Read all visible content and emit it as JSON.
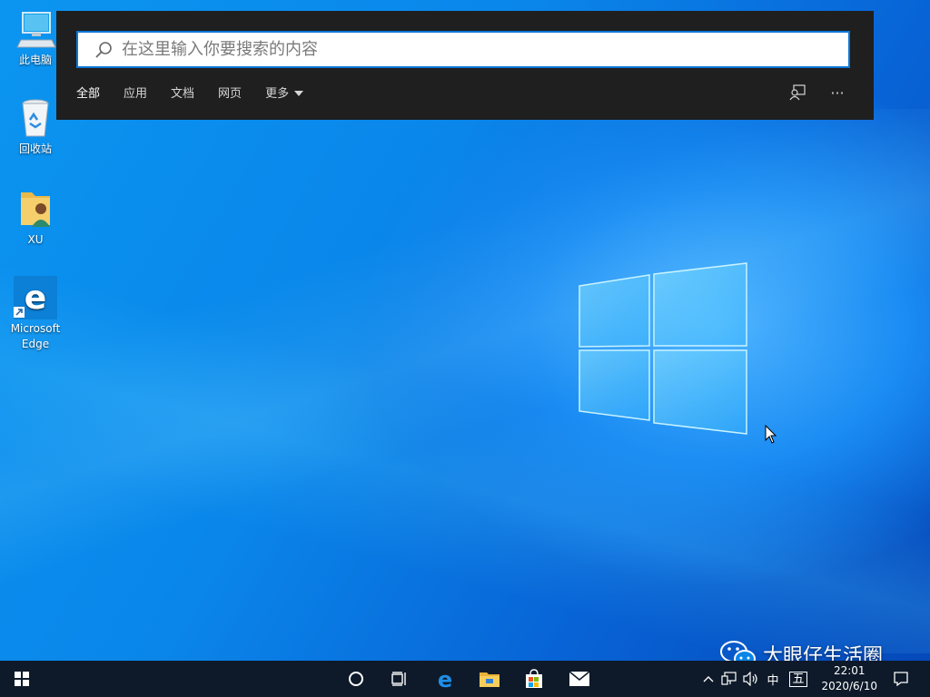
{
  "desktop": {
    "icons": [
      {
        "label": "此电脑",
        "icon": "computer-icon"
      },
      {
        "label": "回收站",
        "icon": "recycle-bin-icon"
      },
      {
        "label": "XU",
        "icon": "user-folder-icon"
      },
      {
        "label": "Microsoft\nEdge",
        "icon": "edge-icon"
      }
    ]
  },
  "search": {
    "placeholder": "在这里输入你要搜索的内容",
    "value": "",
    "tabs": [
      {
        "label": "全部",
        "active": true
      },
      {
        "label": "应用",
        "active": false
      },
      {
        "label": "文档",
        "active": false
      },
      {
        "label": "网页",
        "active": false
      },
      {
        "label": "更多",
        "active": false,
        "dropdown": true
      }
    ],
    "feedback_icon": "feedback-icon",
    "more_icon": "ellipsis-icon",
    "more_glyph": "···"
  },
  "taskbar": {
    "start_icon": "windows-start-icon",
    "pinned": [
      "cortana-icon",
      "task-view-icon",
      "edge-icon",
      "file-explorer-icon",
      "store-icon",
      "mail-icon"
    ],
    "tray": {
      "show_hidden_icon": "chevron-up-icon",
      "network_icon": "network-icon",
      "volume_icon": "volume-icon",
      "ime_mode": "中",
      "ime_layout": "五",
      "time": "22:01",
      "date": "2020/6/10",
      "notification_icon": "action-center-icon"
    }
  },
  "watermark": {
    "text": "大眼仔生活圈",
    "icon": "wechat-icon"
  },
  "colors": {
    "accent": "#0a78d7",
    "panel_bg": "#1f1f1f",
    "taskbar_bg": "#0e1a2a"
  }
}
